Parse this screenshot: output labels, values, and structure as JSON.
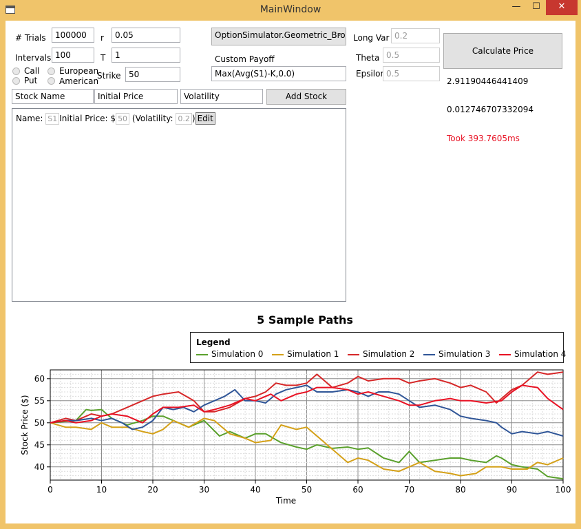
{
  "window": {
    "title": "MainWindow",
    "minimize": "—",
    "maximize": "☐",
    "close": "✕"
  },
  "params": {
    "trials_label": "# Trials",
    "trials_value": "100000",
    "intervals_label": "Intervals",
    "intervals_value": "100",
    "r_label": "r",
    "r_value": "0.05",
    "t_label": "T",
    "t_value": "1",
    "strike_label": "Strike",
    "strike_value": "50",
    "call_label": "Call",
    "put_label": "Put",
    "european_label": "European",
    "american_label": "American"
  },
  "simulator": {
    "selected": "OptionSimulator.Geometric_Bro",
    "custom_payoff_label": "Custom Payoff",
    "custom_payoff_value": "Max(Avg(S1)-K,0.0)"
  },
  "stochastic": {
    "long_var_label": "Long Var",
    "long_var_value": "0.2",
    "theta_label": "Theta",
    "theta_value": "0.5",
    "epsilon_label": "Epsilon",
    "epsilon_value": "0.5"
  },
  "add_stock": {
    "name_value": "Stock Name",
    "price_value": "Initial Price",
    "volatility_value": "Volatility",
    "button_label": "Add Stock"
  },
  "stocks": [
    {
      "name_label": "Name:",
      "name": "S1",
      "price_label": "Initial Price: $",
      "price": "50",
      "vol_label": "(Volatility:",
      "vol": "0.2",
      "close_paren": ")",
      "edit_label": "Edit"
    }
  ],
  "results": {
    "calc_button": "Calculate Price",
    "price": "2.91190446441409",
    "stderr": "0.012746707332094",
    "timing": "Took 393.7605ms",
    "timing_color": "#e81123"
  },
  "chart_data": {
    "type": "line",
    "title": "5 Sample Paths",
    "xlabel": "Time",
    "ylabel": "Stock Price ($)",
    "legend_title": "Legend",
    "legend_position": "top",
    "xlim": [
      0,
      100
    ],
    "ylim": [
      37,
      62
    ],
    "xticks": [
      0,
      10,
      20,
      30,
      40,
      50,
      60,
      70,
      80,
      90,
      100
    ],
    "yticks": [
      40,
      45,
      50,
      55,
      60
    ],
    "grid": true,
    "series": [
      {
        "name": "Simulation 0",
        "color": "#5aa02c",
        "x": [
          0,
          5,
          7,
          8,
          10,
          12,
          15,
          18,
          20,
          22,
          25,
          27,
          30,
          33,
          35,
          38,
          40,
          42,
          45,
          48,
          50,
          52,
          55,
          58,
          60,
          62,
          65,
          68,
          70,
          72,
          75,
          78,
          80,
          82,
          85,
          87,
          88,
          90,
          92,
          95,
          97,
          100
        ],
        "y": [
          50,
          50.5,
          53,
          52.8,
          53,
          51,
          49.5,
          50.5,
          51.5,
          51.5,
          50,
          49,
          50.5,
          47,
          48,
          46.5,
          47.5,
          47.5,
          45.5,
          44.5,
          44,
          45,
          44.2,
          44.5,
          44,
          44.3,
          42,
          41,
          43.5,
          41,
          41.5,
          42,
          42,
          41.5,
          41,
          42.5,
          42,
          40.5,
          40,
          39.5,
          37.8,
          37.3
        ]
      },
      {
        "name": "Simulation 1",
        "color": "#d4a017",
        "x": [
          0,
          3,
          5,
          8,
          10,
          12,
          15,
          18,
          20,
          22,
          24,
          27,
          30,
          32,
          35,
          38,
          40,
          43,
          45,
          48,
          50,
          52,
          55,
          58,
          60,
          62,
          65,
          68,
          70,
          72,
          75,
          78,
          80,
          83,
          85,
          88,
          90,
          93,
          95,
          97,
          100
        ],
        "y": [
          50,
          49,
          49,
          48.5,
          50,
          49,
          49,
          48,
          47.5,
          48.5,
          50.5,
          49,
          51,
          50.5,
          47.5,
          46.5,
          45.5,
          46,
          49.5,
          48.5,
          49,
          47,
          44,
          41,
          42,
          41.5,
          39.5,
          39,
          40,
          41,
          39,
          38.5,
          38,
          38.5,
          40,
          40,
          39.5,
          39.5,
          41,
          40.5,
          42
        ]
      },
      {
        "name": "Simulation 2",
        "color": "#d62728",
        "x": [
          0,
          3,
          5,
          8,
          10,
          12,
          15,
          18,
          20,
          22,
          25,
          28,
          30,
          32,
          35,
          38,
          40,
          42,
          44,
          46,
          48,
          50,
          52,
          55,
          58,
          60,
          62,
          65,
          68,
          70,
          72,
          75,
          78,
          80,
          82,
          85,
          87,
          88,
          90,
          92,
          95,
          97,
          100
        ],
        "y": [
          50,
          51,
          50.5,
          52,
          51.5,
          52,
          53.5,
          55,
          56,
          56.5,
          57,
          55,
          52.5,
          52.5,
          53.5,
          55.5,
          56,
          57,
          59,
          58.5,
          58.5,
          59,
          61,
          58,
          59,
          60.5,
          59.5,
          60,
          60,
          59,
          59.5,
          60,
          59,
          58,
          58.5,
          57,
          54.5,
          55.5,
          57.5,
          58.5,
          61.5,
          61,
          61.5
        ]
      },
      {
        "name": "Simulation 3",
        "color": "#2f5597",
        "x": [
          0,
          3,
          5,
          8,
          10,
          12,
          14,
          16,
          18,
          20,
          22,
          24,
          26,
          28,
          30,
          32,
          34,
          36,
          38,
          40,
          42,
          44,
          46,
          48,
          50,
          52,
          55,
          58,
          60,
          62,
          64,
          66,
          68,
          70,
          72,
          75,
          78,
          80,
          82,
          85,
          87,
          88,
          90,
          92,
          95,
          97,
          100
        ],
        "y": [
          50,
          50.5,
          50.5,
          51,
          50.5,
          51,
          50,
          48.5,
          49,
          50.5,
          53.5,
          53,
          53.5,
          52.5,
          54,
          55,
          56,
          57.5,
          55,
          55,
          54.5,
          56.5,
          57.5,
          58,
          58.5,
          57,
          57,
          57.5,
          57,
          56,
          57,
          57,
          56.5,
          55,
          53.5,
          54,
          53,
          51.5,
          51,
          50.5,
          50,
          49,
          47.5,
          48,
          47.5,
          48,
          47
        ]
      },
      {
        "name": "Simulation 4",
        "color": "#e81123",
        "x": [
          0,
          3,
          5,
          8,
          10,
          12,
          15,
          18,
          20,
          22,
          25,
          28,
          30,
          32,
          35,
          38,
          40,
          43,
          45,
          48,
          50,
          52,
          55,
          58,
          60,
          62,
          65,
          68,
          70,
          72,
          75,
          78,
          80,
          82,
          85,
          88,
          90,
          92,
          95,
          97,
          100
        ],
        "y": [
          50,
          50.5,
          50,
          50.5,
          51.5,
          52,
          51.5,
          50,
          52,
          53.5,
          53.5,
          54,
          52.5,
          53,
          54,
          55.5,
          55,
          56.5,
          55,
          56.5,
          57,
          58,
          58,
          57.5,
          56.5,
          57,
          56,
          55,
          54,
          54,
          55,
          55.5,
          55,
          55,
          54.5,
          55,
          57,
          58.5,
          58,
          55.5,
          53
        ]
      }
    ]
  }
}
